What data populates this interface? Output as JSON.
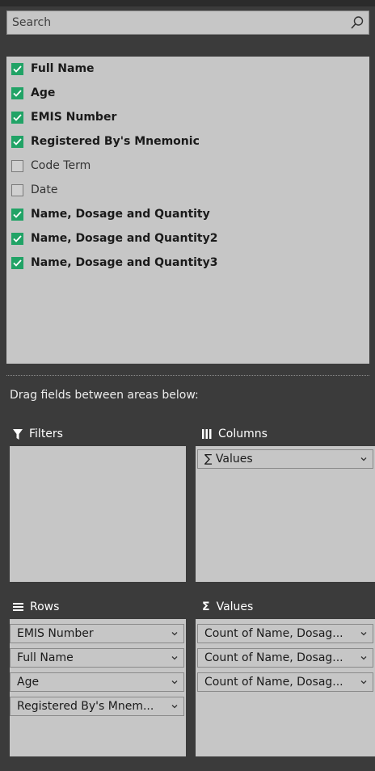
{
  "search": {
    "placeholder": "Search"
  },
  "fields": [
    {
      "label": "Full Name",
      "checked": true
    },
    {
      "label": "Age",
      "checked": true
    },
    {
      "label": "EMIS Number",
      "checked": true
    },
    {
      "label": "Registered By's Mnemonic",
      "checked": true
    },
    {
      "label": "Code Term",
      "checked": false
    },
    {
      "label": "Date",
      "checked": false
    },
    {
      "label": "Name, Dosage and Quantity",
      "checked": true
    },
    {
      "label": "Name, Dosage and Quantity2",
      "checked": true
    },
    {
      "label": "Name, Dosage and Quantity3",
      "checked": true
    }
  ],
  "drag_hint": "Drag fields between areas below:",
  "areas": {
    "filters": {
      "title": "Filters",
      "items": []
    },
    "columns": {
      "title": "Columns",
      "items": [
        "∑ Values"
      ]
    },
    "rows": {
      "title": "Rows",
      "items": [
        "EMIS Number",
        "Full Name",
        "Age",
        "Registered By's Mnem..."
      ]
    },
    "values": {
      "title": "Values",
      "items": [
        "Count of Name, Dosag...",
        "Count of Name, Dosag...",
        "Count of Name, Dosag..."
      ]
    }
  },
  "colors": {
    "checked": "#21a366",
    "panel": "#c6c6c6",
    "background": "#3b3b3b"
  }
}
